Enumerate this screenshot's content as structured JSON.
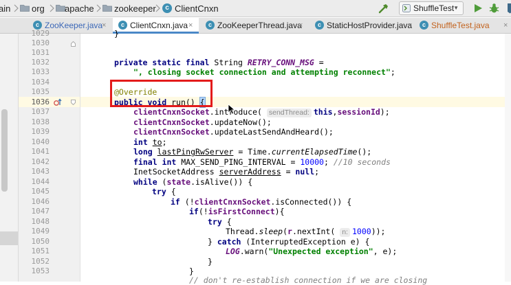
{
  "breadcrumb": {
    "items": [
      "ain",
      "org",
      "apache",
      "zookeeper",
      "ClientCnxn"
    ]
  },
  "toolbar": {
    "run_config": "ShuffleTest"
  },
  "tabs": [
    {
      "label": "ZooKeeper.java",
      "icon": "class-icon",
      "active": false
    },
    {
      "label": "ClientCnxn.java",
      "icon": "class-icon",
      "active": true
    },
    {
      "label": "ZooKeeperThread.java",
      "icon": "class-icon",
      "active": false
    },
    {
      "label": "StaticHostProvider.java",
      "icon": "class-icon",
      "active": false
    },
    {
      "label": "ShuffleTest.java",
      "icon": "class-icon",
      "active": false
    }
  ],
  "tab_close_glyph": "×",
  "editor": {
    "line_numbers": [
      "1029",
      "1030",
      "1031",
      "1032",
      "1033",
      "1034",
      "1035",
      "1036",
      "1037",
      "1038",
      "1039",
      "1040",
      "1041",
      "1042",
      "1043",
      "1044",
      "1045",
      "1046",
      "1047",
      "1048",
      "1049",
      "1050",
      "1051",
      "1052",
      "1053"
    ],
    "current_line": "1036",
    "code": {
      "l1029": "}",
      "l1032_a": "private static final ",
      "l1032_b": "String ",
      "l1032_c": "RETRY_CONN_MSG",
      "l1032_d": " =",
      "l1033": "\", closing socket connection and attempting reconnect\"",
      "l1035": "@Override",
      "l1036_a": "public void ",
      "l1036_b": "run() ",
      "l1036_c": "{",
      "l1037_a": "clientCnxnSocket",
      "l1037_b": ".introduce( ",
      "l1037_hint": "sendThread:",
      "l1037_c": "this",
      "l1037_d": ",",
      "l1037_e": "sessionId",
      "l1037_f": ");",
      "l1038_a": "clientCnxnSocket",
      "l1038_b": ".updateNow();",
      "l1039_a": "clientCnxnSocket",
      "l1039_b": ".updateLastSendAndHeard();",
      "l1040_a": "int ",
      "l1040_b": "to",
      "l1040_c": ";",
      "l1041_a": "long ",
      "l1041_b": "lastPingRwServer",
      "l1041_c": " = Time.",
      "l1041_d": "currentElapsedTime",
      "l1041_e": "();",
      "l1042_a": "final int ",
      "l1042_b": "MAX_SEND_PING_INTERVAL = ",
      "l1042_c": "10000",
      "l1042_d": "; ",
      "l1042_e": "//10 seconds",
      "l1043_a": "InetSocketAddress ",
      "l1043_b": "serverAddress",
      "l1043_c": " = ",
      "l1043_d": "null",
      "l1043_e": ";",
      "l1044_a": "while ",
      "l1044_b": "(",
      "l1044_c": "state",
      "l1044_d": ".isAlive()) {",
      "l1045_a": "try ",
      "l1045_b": "{",
      "l1046_a": "if ",
      "l1046_b": "(!",
      "l1046_c": "clientCnxnSocket",
      "l1046_d": ".isConnected()) {",
      "l1047_a": "if",
      "l1047_b": "(!",
      "l1047_c": "isFirstConnect",
      "l1047_d": "){",
      "l1048_a": "try ",
      "l1048_b": "{",
      "l1049_a": "Thread.",
      "l1049_b": "sleep",
      "l1049_c": "(",
      "l1049_d": "r",
      "l1049_e": ".nextInt( ",
      "l1049_hint": "n:",
      "l1049_f": "1000",
      "l1049_g": "));",
      "l1050_a": "} ",
      "l1050_b": "catch ",
      "l1050_c": "(InterruptedException e) {",
      "l1051_a": "LOG",
      "l1051_b": ".warn(",
      "l1051_c": "\"Unexpected exception\"",
      "l1051_d": ", e);",
      "l1052": "}",
      "l1053_a": "}",
      "l1054": "// don't re-establish connection if we are closing"
    }
  },
  "colors": {
    "highlight_box": "#e31b1b",
    "keyword": "#000080",
    "string": "#008000",
    "field": "#660e7a",
    "annotation": "#808000",
    "number": "#0000ff",
    "comment": "#808080",
    "active_tab_underline": "#4a88c7"
  }
}
